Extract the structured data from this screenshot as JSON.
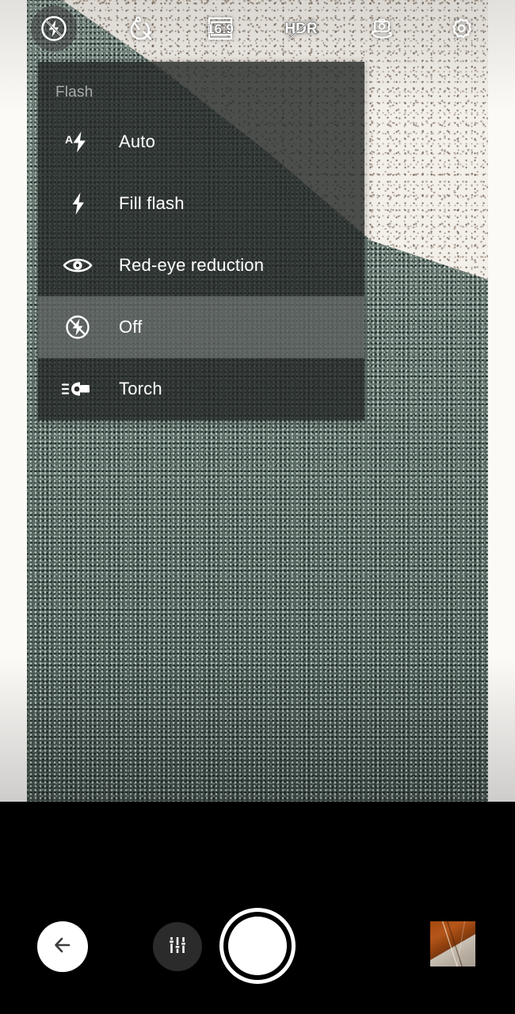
{
  "app": {
    "name": "Camera"
  },
  "toolbar": {
    "items": [
      {
        "name": "flash-off-icon",
        "label": "Flash off",
        "active": true
      },
      {
        "name": "timer-off-icon",
        "label": "Self-timer off",
        "active": false
      },
      {
        "name": "aspect-ratio-icon",
        "label": "16:9",
        "value": "16:9",
        "active": false
      },
      {
        "name": "hdr-off-icon",
        "label": "HDR off",
        "value": "HDR",
        "active": false
      },
      {
        "name": "switch-camera-icon",
        "label": "Switch camera",
        "active": false
      },
      {
        "name": "settings-gear-icon",
        "label": "Settings",
        "active": false
      }
    ]
  },
  "flash_menu": {
    "title": "Flash",
    "selected": "Off",
    "items": [
      {
        "label": "Auto",
        "icon": "flash-auto-icon",
        "selected": false
      },
      {
        "label": "Fill flash",
        "icon": "flash-on-icon",
        "selected": false
      },
      {
        "label": "Red-eye reduction",
        "icon": "eye-icon",
        "selected": false
      },
      {
        "label": "Off",
        "icon": "flash-off-icon",
        "selected": true
      },
      {
        "label": "Torch",
        "icon": "torch-icon",
        "selected": false
      }
    ]
  },
  "controls": {
    "back_label": "Back",
    "manual_label": "Manual controls",
    "shutter_label": "Shutter",
    "thumbnail_label": "Last photo"
  },
  "colors": {
    "menu_background": "#222524",
    "menu_selected": "#bec4c1",
    "menu_title_text": "#a8adab",
    "menu_item_text": "#ffffff",
    "control_bar": "#000000",
    "shutter": "#ffffff",
    "manual_button": "#2b2b2b",
    "carpet": "#5f6f6a",
    "wall": "#f3efe9"
  }
}
